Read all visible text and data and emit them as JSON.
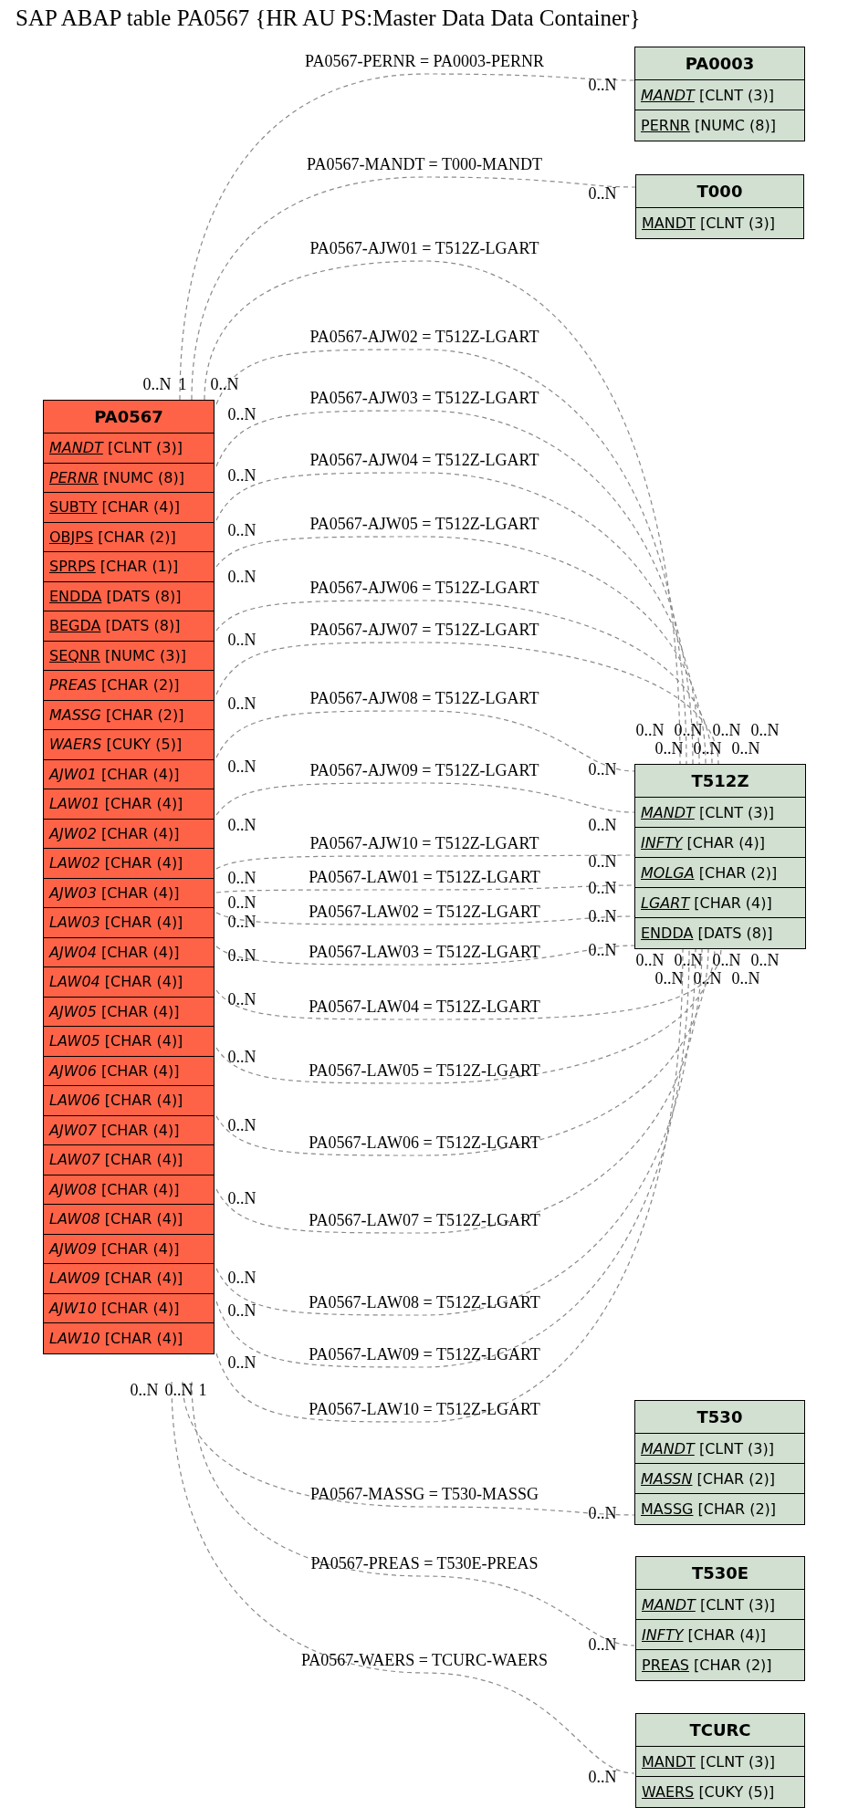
{
  "title": "SAP ABAP table PA0567 {HR AU PS:Master Data Data Container}",
  "tables": [
    {
      "name": "PA0567",
      "color": "#ff6347",
      "fields": [
        {
          "name": "MANDT",
          "type": "[CLNT (3)]",
          "key": true,
          "italic": true
        },
        {
          "name": "PERNR",
          "type": "[NUMC (8)]",
          "key": true,
          "italic": true
        },
        {
          "name": "SUBTY",
          "type": "[CHAR (4)]",
          "key": true,
          "italic": false
        },
        {
          "name": "OBJPS",
          "type": "[CHAR (2)]",
          "key": true,
          "italic": false
        },
        {
          "name": "SPRPS",
          "type": "[CHAR (1)]",
          "key": true,
          "italic": false
        },
        {
          "name": "ENDDA",
          "type": "[DATS (8)]",
          "key": true,
          "italic": false
        },
        {
          "name": "BEGDA",
          "type": "[DATS (8)]",
          "key": true,
          "italic": false
        },
        {
          "name": "SEQNR",
          "type": "[NUMC (3)]",
          "key": true,
          "italic": false
        },
        {
          "name": "PREAS",
          "type": "[CHAR (2)]",
          "key": false,
          "italic": true
        },
        {
          "name": "MASSG",
          "type": "[CHAR (2)]",
          "key": false,
          "italic": true
        },
        {
          "name": "WAERS",
          "type": "[CUKY (5)]",
          "key": false,
          "italic": true
        },
        {
          "name": "AJW01",
          "type": "[CHAR (4)]",
          "key": false,
          "italic": true
        },
        {
          "name": "LAW01",
          "type": "[CHAR (4)]",
          "key": false,
          "italic": true
        },
        {
          "name": "AJW02",
          "type": "[CHAR (4)]",
          "key": false,
          "italic": true
        },
        {
          "name": "LAW02",
          "type": "[CHAR (4)]",
          "key": false,
          "italic": true
        },
        {
          "name": "AJW03",
          "type": "[CHAR (4)]",
          "key": false,
          "italic": true
        },
        {
          "name": "LAW03",
          "type": "[CHAR (4)]",
          "key": false,
          "italic": true
        },
        {
          "name": "AJW04",
          "type": "[CHAR (4)]",
          "key": false,
          "italic": true
        },
        {
          "name": "LAW04",
          "type": "[CHAR (4)]",
          "key": false,
          "italic": true
        },
        {
          "name": "AJW05",
          "type": "[CHAR (4)]",
          "key": false,
          "italic": true
        },
        {
          "name": "LAW05",
          "type": "[CHAR (4)]",
          "key": false,
          "italic": true
        },
        {
          "name": "AJW06",
          "type": "[CHAR (4)]",
          "key": false,
          "italic": true
        },
        {
          "name": "LAW06",
          "type": "[CHAR (4)]",
          "key": false,
          "italic": true
        },
        {
          "name": "AJW07",
          "type": "[CHAR (4)]",
          "key": false,
          "italic": true
        },
        {
          "name": "LAW07",
          "type": "[CHAR (4)]",
          "key": false,
          "italic": true
        },
        {
          "name": "AJW08",
          "type": "[CHAR (4)]",
          "key": false,
          "italic": true
        },
        {
          "name": "LAW08",
          "type": "[CHAR (4)]",
          "key": false,
          "italic": true
        },
        {
          "name": "AJW09",
          "type": "[CHAR (4)]",
          "key": false,
          "italic": true
        },
        {
          "name": "LAW09",
          "type": "[CHAR (4)]",
          "key": false,
          "italic": true
        },
        {
          "name": "AJW10",
          "type": "[CHAR (4)]",
          "key": false,
          "italic": true
        },
        {
          "name": "LAW10",
          "type": "[CHAR (4)]",
          "key": false,
          "italic": true
        }
      ]
    },
    {
      "name": "PA0003",
      "color": "#d1e0d1",
      "fields": [
        {
          "name": "MANDT",
          "type": "[CLNT (3)]",
          "key": true,
          "italic": true
        },
        {
          "name": "PERNR",
          "type": "[NUMC (8)]",
          "key": true,
          "italic": false
        }
      ]
    },
    {
      "name": "T000",
      "color": "#d1e0d1",
      "fields": [
        {
          "name": "MANDT",
          "type": "[CLNT (3)]",
          "key": true,
          "italic": false
        }
      ]
    },
    {
      "name": "T512Z",
      "color": "#d1e0d1",
      "fields": [
        {
          "name": "MANDT",
          "type": "[CLNT (3)]",
          "key": true,
          "italic": true
        },
        {
          "name": "INFTY",
          "type": "[CHAR (4)]",
          "key": true,
          "italic": true
        },
        {
          "name": "MOLGA",
          "type": "[CHAR (2)]",
          "key": true,
          "italic": true
        },
        {
          "name": "LGART",
          "type": "[CHAR (4)]",
          "key": true,
          "italic": true
        },
        {
          "name": "ENDDA",
          "type": "[DATS (8)]",
          "key": true,
          "italic": false
        }
      ]
    },
    {
      "name": "T530",
      "color": "#d1e0d1",
      "fields": [
        {
          "name": "MANDT",
          "type": "[CLNT (3)]",
          "key": true,
          "italic": true
        },
        {
          "name": "MASSN",
          "type": "[CHAR (2)]",
          "key": true,
          "italic": true
        },
        {
          "name": "MASSG",
          "type": "[CHAR (2)]",
          "key": true,
          "italic": false
        }
      ]
    },
    {
      "name": "T530E",
      "color": "#d1e0d1",
      "fields": [
        {
          "name": "MANDT",
          "type": "[CLNT (3)]",
          "key": true,
          "italic": true
        },
        {
          "name": "INFTY",
          "type": "[CHAR (4)]",
          "key": true,
          "italic": true
        },
        {
          "name": "PREAS",
          "type": "[CHAR (2)]",
          "key": true,
          "italic": false
        }
      ]
    },
    {
      "name": "TCURC",
      "color": "#d1e0d1",
      "fields": [
        {
          "name": "MANDT",
          "type": "[CLNT (3)]",
          "key": true,
          "italic": false
        },
        {
          "name": "WAERS",
          "type": "[CUKY (5)]",
          "key": true,
          "italic": false
        }
      ]
    }
  ],
  "relations": [
    {
      "label": "PA0567-PERNR = PA0003-PERNR",
      "source_card": "0..N",
      "target_card": "0..N"
    },
    {
      "label": "PA0567-MANDT = T000-MANDT",
      "source_card": "1",
      "target_card": "0..N"
    },
    {
      "label": "PA0567-AJW01 = T512Z-LGART",
      "source_card": "0..N",
      "target_card": "0..N"
    },
    {
      "label": "PA0567-AJW02 = T512Z-LGART",
      "source_card": "0..N",
      "target_card": "0..N"
    },
    {
      "label": "PA0567-AJW03 = T512Z-LGART",
      "source_card": "0..N",
      "target_card": "0..N"
    },
    {
      "label": "PA0567-AJW04 = T512Z-LGART",
      "source_card": "0..N",
      "target_card": "0..N"
    },
    {
      "label": "PA0567-AJW05 = T512Z-LGART",
      "source_card": "0..N",
      "target_card": "0..N"
    },
    {
      "label": "PA0567-AJW06 = T512Z-LGART",
      "source_card": "0..N",
      "target_card": "0..N"
    },
    {
      "label": "PA0567-AJW07 = T512Z-LGART",
      "source_card": "0..N",
      "target_card": "0..N"
    },
    {
      "label": "PA0567-AJW08 = T512Z-LGART",
      "source_card": "0..N",
      "target_card": "0..N"
    },
    {
      "label": "PA0567-AJW09 = T512Z-LGART",
      "source_card": "0..N",
      "target_card": "0..N"
    },
    {
      "label": "PA0567-AJW10 = T512Z-LGART",
      "source_card": "0..N",
      "target_card": "0..N"
    },
    {
      "label": "PA0567-LAW01 = T512Z-LGART",
      "source_card": "0..N",
      "target_card": "0..N"
    },
    {
      "label": "PA0567-LAW02 = T512Z-LGART",
      "source_card": "0..N",
      "target_card": "0..N"
    },
    {
      "label": "PA0567-LAW03 = T512Z-LGART",
      "source_card": "0..N",
      "target_card": "0..N"
    },
    {
      "label": "PA0567-LAW04 = T512Z-LGART",
      "source_card": "0..N",
      "target_card": "0..N"
    },
    {
      "label": "PA0567-LAW05 = T512Z-LGART",
      "source_card": "0..N",
      "target_card": "0..N"
    },
    {
      "label": "PA0567-LAW06 = T512Z-LGART",
      "source_card": "0..N",
      "target_card": "0..N"
    },
    {
      "label": "PA0567-LAW07 = T512Z-LGART",
      "source_card": "0..N",
      "target_card": "0..N"
    },
    {
      "label": "PA0567-LAW08 = T512Z-LGART",
      "source_card": "0..N",
      "target_card": "0..N"
    },
    {
      "label": "PA0567-LAW09 = T512Z-LGART",
      "source_card": "0..N",
      "target_card": "0..N"
    },
    {
      "label": "PA0567-LAW10 = T512Z-LGART",
      "source_card": "0..N",
      "target_card": "0..N"
    },
    {
      "label": "PA0567-MASSG = T530-MASSG",
      "source_card": "0..N",
      "target_card": "0..N"
    },
    {
      "label": "PA0567-PREAS = T530E-PREAS",
      "source_card": "0..N",
      "target_card": "0..N"
    },
    {
      "label": "PA0567-WAERS = TCURC-WAERS",
      "source_card": "1",
      "target_card": "0..N"
    }
  ]
}
